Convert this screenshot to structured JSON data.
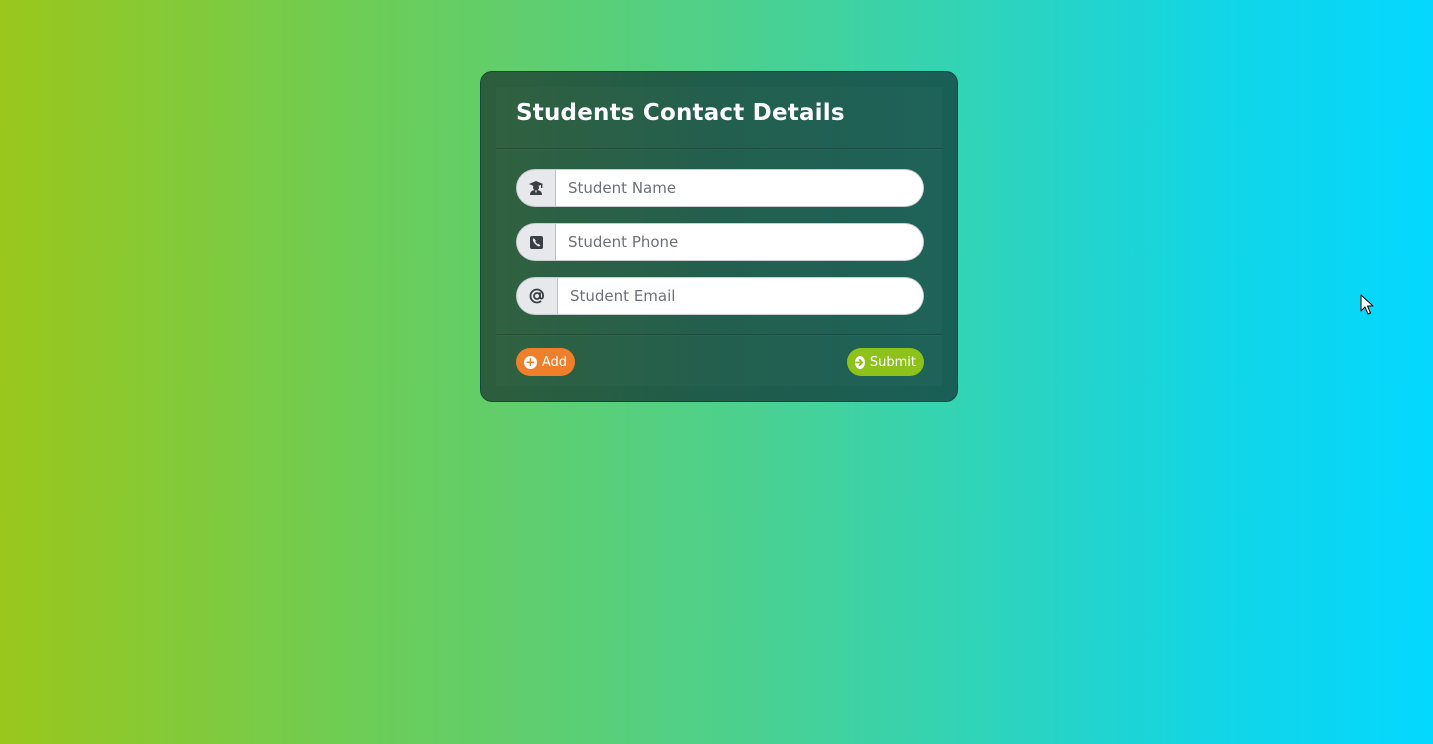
{
  "form": {
    "title": "Students Contact Details",
    "fields": [
      {
        "icon": "student-icon",
        "placeholder": "Student Name",
        "value": ""
      },
      {
        "icon": "phone-icon",
        "placeholder": "Student Phone",
        "value": ""
      },
      {
        "icon": "at-icon",
        "placeholder": "Student Email",
        "value": ""
      }
    ],
    "add_label": "Add",
    "submit_label": "Submit",
    "add_icon": "plus-circle-icon",
    "submit_icon": "arrow-circle-right-icon"
  },
  "colors": {
    "add_button": "#f07f2c",
    "submit_button": "#8cc21a",
    "card": "#1f5c4b",
    "background_left": "#9ac71b",
    "background_right": "#03d8ff"
  }
}
